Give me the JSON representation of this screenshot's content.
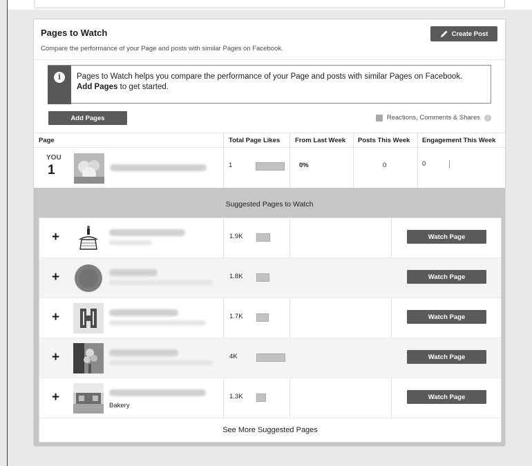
{
  "card": {
    "title": "Pages to Watch",
    "subtitle": "Compare the performance of your Page and posts with similar Pages on Facebook.",
    "create_post_label": "Create Post"
  },
  "info": {
    "text_start": "Pages to Watch helps you compare the performance of your Page and posts with similar Pages on Facebook.",
    "text_bold": "Add Pages",
    "text_end": "to get started."
  },
  "actions": {
    "add_pages_label": "Add Pages"
  },
  "legend": {
    "label": "Reactions, Comments & Shares",
    "help_glyph": "i"
  },
  "table": {
    "headers": [
      "Page",
      "Total Page Likes",
      "From Last Week",
      "Posts This Week",
      "Engagement This Week"
    ]
  },
  "you_row": {
    "label": "YOU",
    "rank": "1",
    "total_likes": "1",
    "likes_level": 1.0,
    "from_last_week": "0%",
    "posts_this_week": "0",
    "engagement": "0"
  },
  "suggested": {
    "title": "Suggested Pages to Watch",
    "add_glyph": "+",
    "watch_label": "Watch Page",
    "rows": [
      {
        "likes": "1.9K",
        "likes_level": 0.475,
        "subtitle": ""
      },
      {
        "likes": "1.8K",
        "likes_level": 0.45,
        "subtitle": ""
      },
      {
        "likes": "1.7K",
        "likes_level": 0.425,
        "subtitle": ""
      },
      {
        "likes": "4K",
        "likes_level": 1.0,
        "subtitle": ""
      },
      {
        "likes": "1.3K",
        "likes_level": 0.325,
        "subtitle": "Bakery"
      }
    ],
    "see_more_label": "See More Suggested Pages"
  },
  "colors": {
    "button_bg": "#5a5a5a",
    "suggest_bg": "#c6c6c6",
    "bar_fill": "#c2c2c2"
  }
}
